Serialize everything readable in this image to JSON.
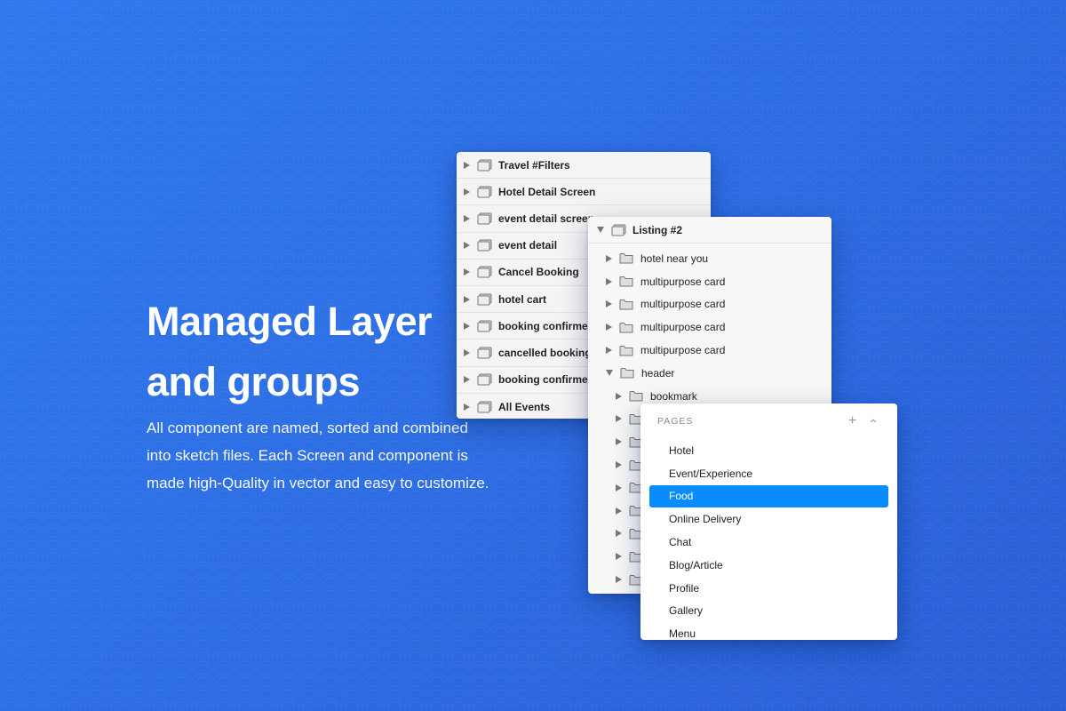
{
  "hero": {
    "title_line1": "Managed Layer",
    "title_line2": "and groups",
    "description": "All component are named, sorted and combined into sketch files. Each Screen and component is made high-Quality in vector and easy to customize."
  },
  "artboards_panel": {
    "items": [
      {
        "label": "Travel #Filters"
      },
      {
        "label": "Hotel Detail Screen"
      },
      {
        "label": "event detail screen"
      },
      {
        "label": "event detail"
      },
      {
        "label": "Cancel Booking"
      },
      {
        "label": "hotel cart"
      },
      {
        "label": "booking confirmed"
      },
      {
        "label": "cancelled booking"
      },
      {
        "label": "booking confirmed"
      },
      {
        "label": "All Events"
      }
    ]
  },
  "layers_panel": {
    "title": "Listing #2",
    "groups": [
      {
        "label": "hotel near you"
      },
      {
        "label": "multipurpose card"
      },
      {
        "label": "multipurpose card"
      },
      {
        "label": "multipurpose card"
      },
      {
        "label": "multipurpose card"
      },
      {
        "label": "header"
      },
      {
        "label": "bookmark"
      }
    ]
  },
  "pages_panel": {
    "heading": "PAGES",
    "add_symbol": "+",
    "collapse_symbol": "⌃",
    "items": [
      {
        "label": "Hotel"
      },
      {
        "label": "Event/Experience"
      },
      {
        "label": "Food"
      },
      {
        "label": "Online Delivery"
      },
      {
        "label": "Chat"
      },
      {
        "label": "Blog/Article"
      },
      {
        "label": "Profile"
      },
      {
        "label": "Gallery"
      },
      {
        "label": "Menu"
      }
    ],
    "active_index": 2
  },
  "icons": {
    "artboard": "artboard-icon",
    "group": "folder-icon",
    "expand": "triangle-right-icon",
    "expanded": "triangle-down-icon"
  },
  "colors": {
    "background": "#2d6de3",
    "selection": "#0a8cff",
    "panel": "#f4f4f4"
  }
}
